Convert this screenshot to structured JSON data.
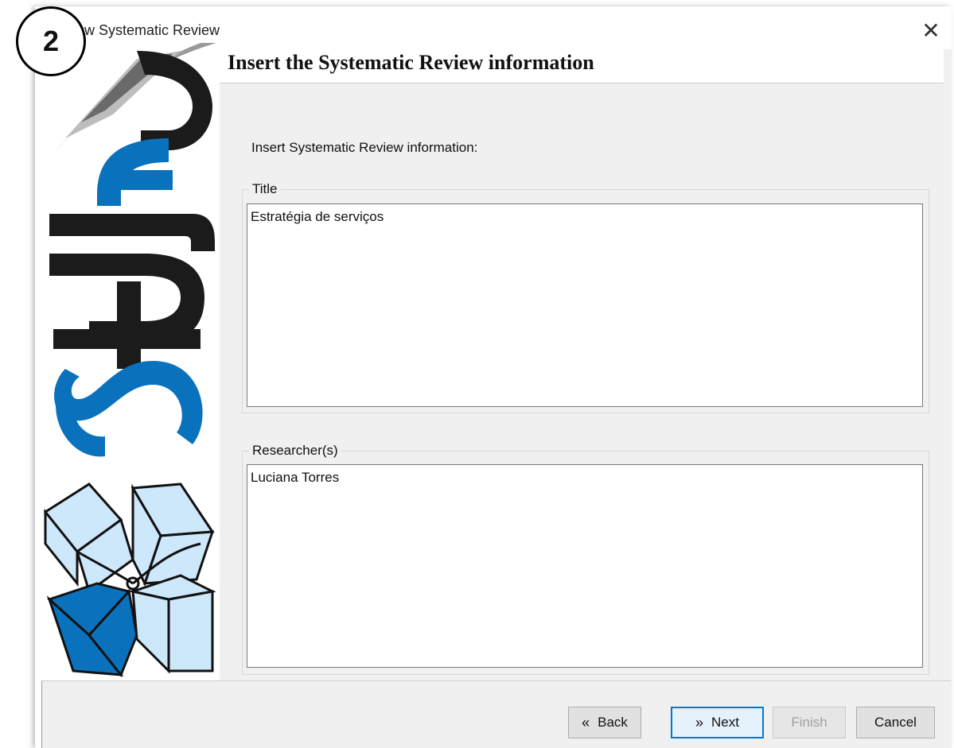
{
  "window": {
    "title": "w Systematic Review",
    "close_glyph": "✕"
  },
  "step_badge": "2",
  "header": {
    "title": "Insert the Systematic Review information"
  },
  "instruction": "Insert Systematic Review information:",
  "title_group": {
    "label": "Title",
    "value": "Estratégia de serviços"
  },
  "researchers_group": {
    "label": "Researcher(s)",
    "value": "Luciana Torres"
  },
  "buttons": {
    "back": "Back",
    "next": "Next",
    "finish": "Finish",
    "cancel": "Cancel",
    "back_icon": "«",
    "next_icon": "»"
  },
  "colors": {
    "logo_blue": "#0a72bd",
    "logo_light_blue": "#cde7fb",
    "accent": "#0078d7"
  },
  "icons": {
    "close": "close-icon",
    "back": "double-chevron-left-icon",
    "next": "double-chevron-right-icon"
  }
}
